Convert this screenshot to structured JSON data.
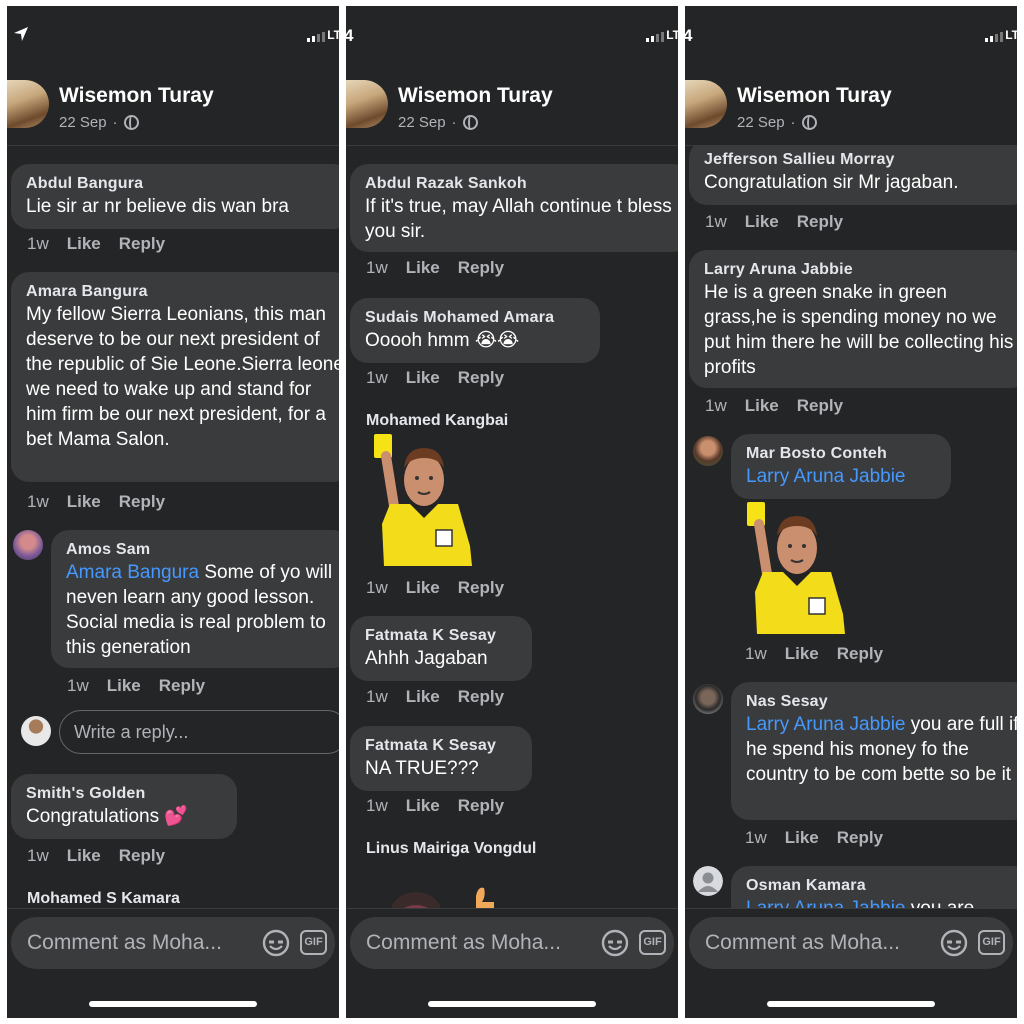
{
  "panels": [
    {
      "status": {
        "time": "",
        "carrier": "LT"
      },
      "post": {
        "author": "Wisemon Turay",
        "date": "22 Sep",
        "separator": "·"
      },
      "comments": [
        {
          "name": "Abdul Bangura",
          "text": "Lie sir ar nr believe dis wan bra",
          "age": "1w",
          "like": "Like",
          "reply": "Reply"
        },
        {
          "name": "Amara Bangura",
          "text": "My fellow Sierra Leonians, this man deserve to be our next president of the republic of Sie Leone.Sierra leone we need to wake up and stand for him firm be our next president, for a bet Mama Salon.",
          "age": "1w",
          "like": "Like",
          "reply": "Reply"
        },
        {
          "name": "Amos Sam",
          "tag": "Amara Bangura",
          "text": " Some of yo will neven learn any good lesson. Social media is real problem to this generation",
          "age": "1w",
          "like": "Like",
          "reply": "Reply"
        },
        {
          "name": "Smith's Golden",
          "text": "Congratulations 💕",
          "age": "1w",
          "like": "Like",
          "reply": "Reply"
        },
        {
          "name": "Mohamed S Kamara"
        }
      ],
      "reply_placeholder": "Write a reply...",
      "composer": {
        "placeholder": "Comment as Moha...",
        "gif": "GIF"
      }
    },
    {
      "status": {
        "time": "4",
        "carrier": "LT"
      },
      "post": {
        "author": "Wisemon Turay",
        "date": "22 Sep",
        "separator": "·"
      },
      "comments": [
        {
          "name": "Abdul Razak Sankoh",
          "text": "If it's true, may Allah continue t bless you sir.",
          "age": "1w",
          "like": "Like",
          "reply": "Reply"
        },
        {
          "name": "Sudais Mohamed Amara",
          "text": "Ooooh hmm 😭😭",
          "age": "1w",
          "like": "Like",
          "reply": "Reply"
        },
        {
          "name": "Mohamed Kangbai",
          "sticker": "referee-yellow-card",
          "age": "1w",
          "like": "Like",
          "reply": "Reply"
        },
        {
          "name": "Fatmata K Sesay",
          "text": "Ahhh Jagaban",
          "age": "1w",
          "like": "Like",
          "reply": "Reply"
        },
        {
          "name": "Fatmata K Sesay",
          "text": "NA TRUE???",
          "age": "1w",
          "like": "Like",
          "reply": "Reply"
        },
        {
          "name": "Linus Mairiga Vongdul"
        }
      ],
      "composer": {
        "placeholder": "Comment as Moha...",
        "gif": "GIF"
      }
    },
    {
      "status": {
        "time": "4",
        "carrier": "LT"
      },
      "post": {
        "author": "Wisemon Turay",
        "date": "22 Sep",
        "separator": "·"
      },
      "comments": [
        {
          "name": "Jefferson Sallieu Morray",
          "text": "Congratulation sir Mr jagaban.",
          "age": "1w",
          "like": "Like",
          "reply": "Reply"
        },
        {
          "name": "Larry Aruna Jabbie",
          "text": "He is a green snake in green grass,he is spending money no we put him there he will be collecting his profits",
          "age": "1w",
          "like": "Like",
          "reply": "Reply"
        },
        {
          "name": "Mar Bosto Conteh",
          "tag": "Larry Aruna Jabbie",
          "sticker": "referee-yellow-card",
          "age": "1w",
          "like": "Like",
          "reply": "Reply"
        },
        {
          "name": "Nas Sesay",
          "tag": "Larry Aruna Jabbie",
          "text": " you are full if he spend his money fo the country to be com bette so be it",
          "age": "1w",
          "like": "Like",
          "reply": "Reply"
        },
        {
          "name": "Osman Kamara",
          "tag": "Larry Aruna Jabbie",
          "text": " you are"
        }
      ],
      "composer": {
        "placeholder": "Comment as Moha...",
        "gif": "GIF"
      }
    }
  ],
  "colors": {
    "background": "#242526",
    "bubble": "#3a3b3c",
    "tag": "#4599ff",
    "muted": "#b0b3b8"
  },
  "icons": [
    "location-arrow-icon",
    "signal-icon",
    "globe-icon",
    "emoji-icon",
    "gif-icon"
  ]
}
